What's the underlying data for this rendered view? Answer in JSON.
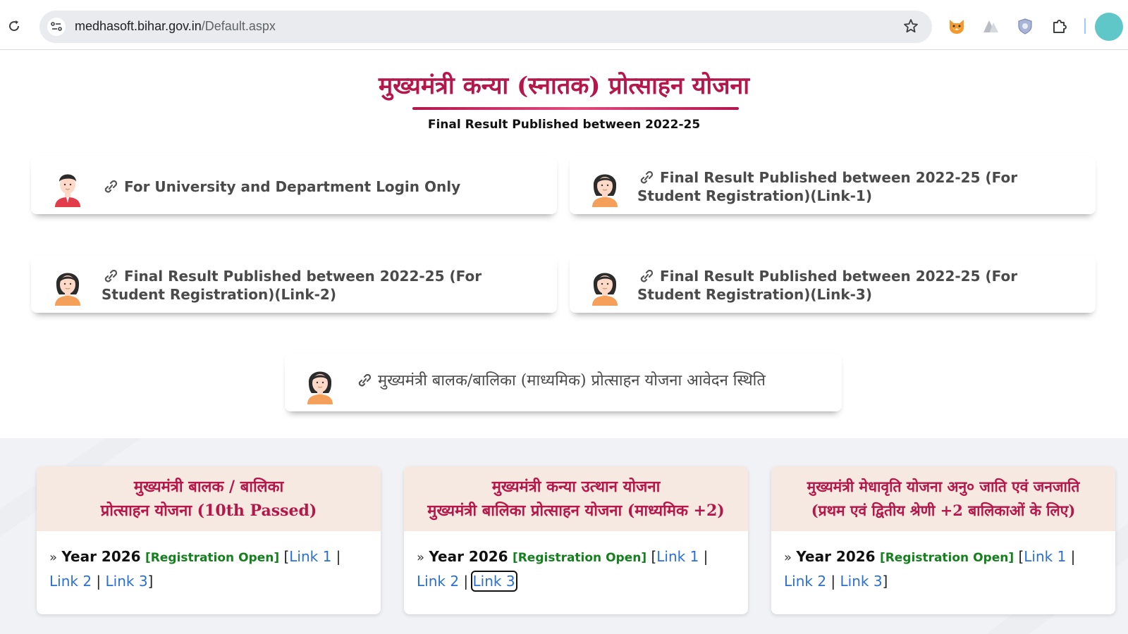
{
  "browser": {
    "url_host": "medhasoft.bihar.gov.in",
    "url_path": "/Default.aspx"
  },
  "header": {
    "title": "मुख्यमंत्री कन्या (स्नातक) प्रोत्साहन योजना",
    "subtitle": "Final Result Published between 2022-25"
  },
  "links": [
    {
      "label": "For University and Department Login Only",
      "avatar": "male-user-icon"
    },
    {
      "label": "Final Result Published between 2022-25 (For Student Registration)(Link-1)",
      "avatar": "female-user-icon"
    },
    {
      "label": "Final Result Published between 2022-25 (For Student Registration)(Link-2)",
      "avatar": "female-user-icon"
    },
    {
      "label": "Final Result Published between 2022-25 (For Student Registration)(Link-3)",
      "avatar": "female-user-icon"
    },
    {
      "label": "मुख्यमंत्री बालक/बालिका (माध्यमिक) प्रोत्साहन योजना आवेदन स्थिति",
      "avatar": "female-user-icon"
    }
  ],
  "schemes": [
    {
      "title_line1": "मुख्यमंत्री बालक / बालिका",
      "title_line2": "प्रोत्साहन योजना (10th Passed)",
      "year": "Year 2026",
      "status": "[Registration Open]",
      "link1": "Link 1",
      "link2": "Link 2",
      "link3": "Link 3"
    },
    {
      "title_line1": "मुख्यमंत्री कन्या उत्थान योजना",
      "title_line2": "मुख्यमंत्री बालिका प्रोत्साहन योजना (माध्यमिक +2)",
      "year": "Year 2026",
      "status": "[Registration Open]",
      "link1": "Link 1",
      "link2": "Link 2",
      "link3": "Link 3"
    },
    {
      "title_line1": "मुख्यमंत्री मेधावृति योजना अनु० जाति एवं जनजाति",
      "title_line2": "(प्रथम एवं द्वितीय श्रेणी +2 बालिकाओं के लिए)",
      "year": "Year 2026",
      "status": "[Registration Open]",
      "link1": "Link 1",
      "link2": "Link 2",
      "link3": "Link 3"
    }
  ],
  "colors": {
    "accent": "#b5174b",
    "link": "#2a6fd6",
    "status": "#14801e",
    "card_header": "#f6e9e1"
  }
}
